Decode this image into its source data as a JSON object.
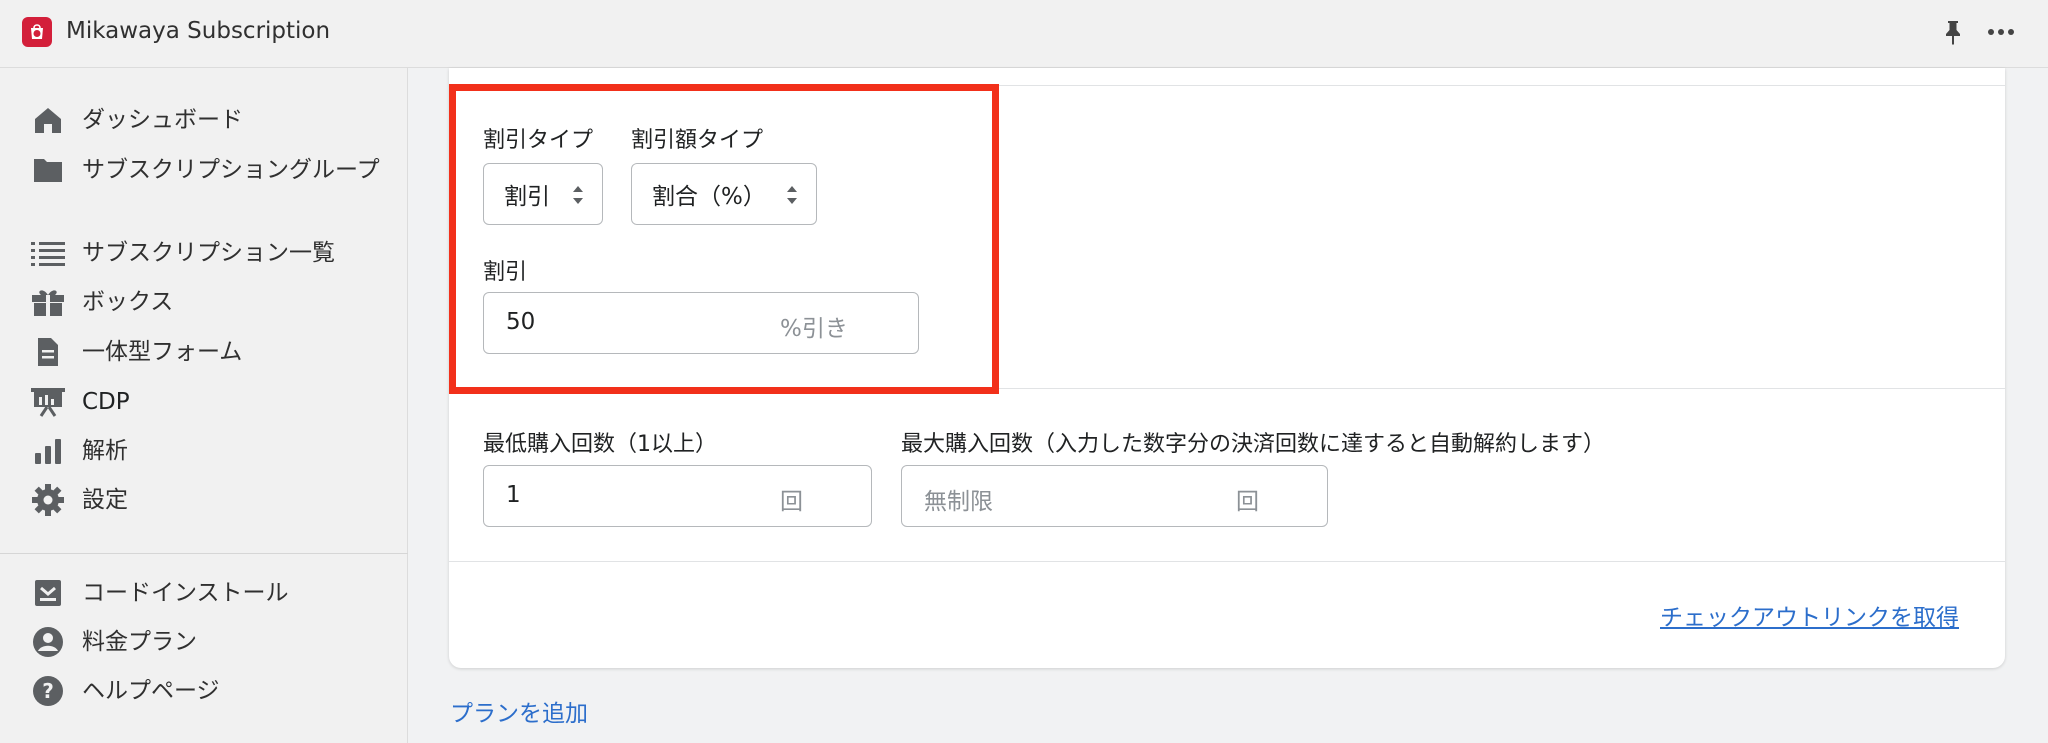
{
  "app": {
    "title": "Mikawaya Subscription",
    "brand_color": "#d31f3a"
  },
  "topbar": {
    "pin_icon": "pin-icon",
    "more_icon": "more-icon"
  },
  "sidebar": {
    "items": [
      {
        "label": "ダッシュボード",
        "icon": "home-icon"
      },
      {
        "label": "サブスクリプショングループ",
        "icon": "folder-icon"
      },
      {
        "label": "サブスクリプション一覧",
        "icon": "list-icon"
      },
      {
        "label": "ボックス",
        "icon": "gift-icon"
      },
      {
        "label": "一体型フォーム",
        "icon": "document-icon"
      },
      {
        "label": "CDP",
        "icon": "presentation-icon"
      },
      {
        "label": "解析",
        "icon": "bar-chart-icon"
      },
      {
        "label": "設定",
        "icon": "gear-icon"
      }
    ],
    "bottom_items": [
      {
        "label": "コードインストール",
        "icon": "install-icon"
      },
      {
        "label": "料金プラン",
        "icon": "user-circle-icon"
      },
      {
        "label": "ヘルプページ",
        "icon": "help-icon"
      }
    ]
  },
  "form": {
    "discount_type": {
      "label": "割引タイプ",
      "value": "割引"
    },
    "discount_amount_type": {
      "label": "割引額タイプ",
      "value": "割合（%）"
    },
    "discount": {
      "label": "割引",
      "value": "50",
      "suffix": "%引き"
    },
    "min_purchase": {
      "label": "最低購入回数（1以上）",
      "value": "1",
      "suffix": "回"
    },
    "max_purchase": {
      "label": "最大購入回数（入力した数字分の決済回数に達すると自動解約します）",
      "placeholder": "無制限",
      "suffix": "回"
    },
    "checkout_link": "チェックアウトリンクを取得"
  },
  "add_plan": "プランを追加",
  "colors": {
    "highlight": "#f2301a",
    "link": "#2c6ecb"
  }
}
